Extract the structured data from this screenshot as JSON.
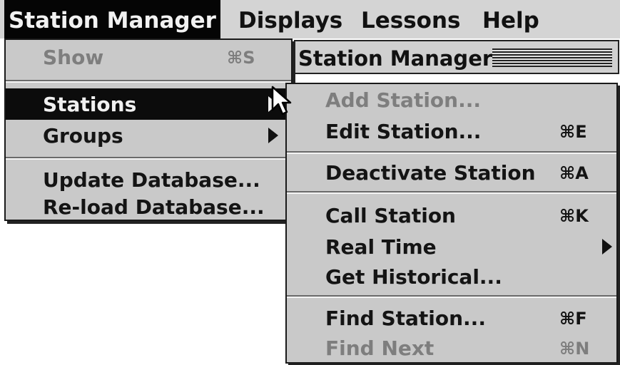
{
  "menubar": {
    "items": [
      "Station Manager",
      "Displays",
      "Lessons",
      "Help"
    ]
  },
  "window": {
    "title": "Station Manager"
  },
  "station_manager_menu": {
    "show": {
      "label": "Show",
      "shortcut": "⌘S"
    },
    "stations": {
      "label": "Stations"
    },
    "groups": {
      "label": "Groups"
    },
    "update_database": {
      "label": "Update Database..."
    },
    "reload_database": {
      "label": "Re-load Database..."
    }
  },
  "stations_submenu": {
    "add_station": {
      "label": "Add Station..."
    },
    "edit_station": {
      "label": "Edit Station...",
      "shortcut": "⌘E"
    },
    "deactivate_station": {
      "label": "Deactivate Station",
      "shortcut": "⌘A"
    },
    "call_station": {
      "label": "Call Station",
      "shortcut": "⌘K"
    },
    "real_time": {
      "label": "Real Time"
    },
    "get_historical": {
      "label": "Get Historical..."
    },
    "find_station": {
      "label": "Find Station...",
      "shortcut": "⌘F"
    },
    "find_next": {
      "label": "Find Next",
      "shortcut": "⌘N"
    }
  }
}
